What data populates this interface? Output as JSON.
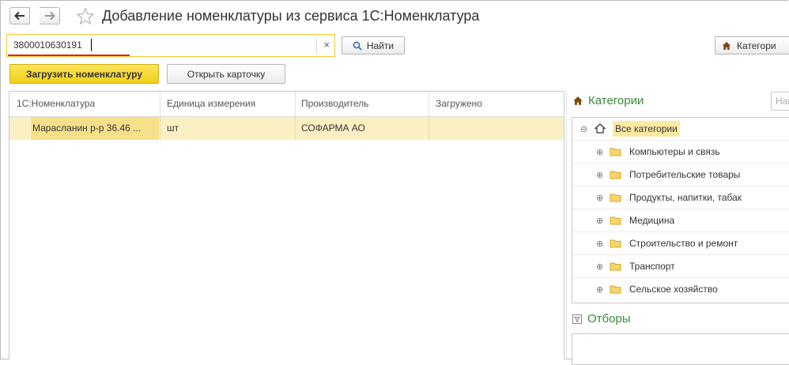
{
  "window": {
    "title": "Добавление номенклатуры из сервиса 1С:Номенклатура"
  },
  "search": {
    "value": "3800010630191",
    "clear_symbol": "×"
  },
  "buttons": {
    "find": "Найти",
    "categories": "Категори",
    "load": "Загрузить номенклатуру",
    "open_card": "Открыть карточку"
  },
  "table": {
    "columns": [
      "1С:Номенклатура",
      "Единица измерения",
      "Производитель",
      "Загружено"
    ],
    "rows": [
      {
        "name": "Марасланин р-р 36.46 ...",
        "unit": "шт",
        "manufacturer": "СОФАРМА АО",
        "loaded": ""
      }
    ]
  },
  "categories": {
    "title": "Категории",
    "search_placeholder": "Най",
    "root": "Все категории",
    "items": [
      "Компьютеры и связь",
      "Потребительские товары",
      "Продукты, напитки, табак",
      "Медицина",
      "Строительство и ремонт",
      "Транспорт",
      "Сельское хозяйство"
    ]
  },
  "filters": {
    "title": "Отборы"
  },
  "colors": {
    "accent_yellow": "#f1cf1a",
    "selection": "#f7e08a",
    "row_highlight": "#fbf0c4",
    "green_heading": "#3a8a3a",
    "red_underline": "#e02020"
  }
}
